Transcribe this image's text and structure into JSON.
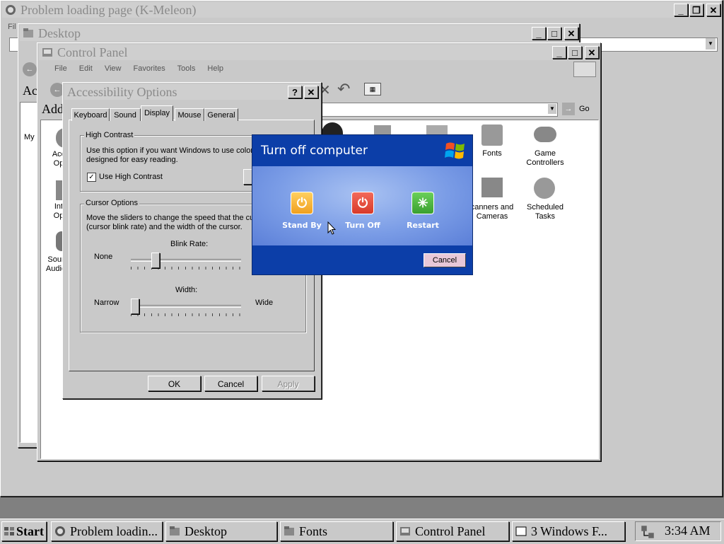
{
  "browser": {
    "title": "Problem loading page (K-Meleon)",
    "menu_first_letter": "Fil"
  },
  "desktop_window": {
    "title": "Desktop"
  },
  "control_panel": {
    "title": "Control Panel",
    "menu": [
      "File",
      "Edit",
      "View",
      "Favorites",
      "Tools",
      "Help"
    ],
    "address_label": "Add",
    "go_label": "Go",
    "left_fragment_1": "Ac",
    "left_fragment_2": "My",
    "icons": [
      {
        "label": "Acc\nOp"
      },
      {
        "label": "Int\nOp"
      },
      {
        "label": "Sour\nAudio"
      },
      {
        "label": "Fonts"
      },
      {
        "label": "Game\nControllers"
      },
      {
        "label": "canners and\nCameras"
      },
      {
        "label": "Scheduled\nTasks"
      }
    ]
  },
  "accessibility": {
    "title": "Accessibility Options",
    "tabs": [
      "Keyboard",
      "Sound",
      "Display",
      "Mouse",
      "General"
    ],
    "active_tab": "Display",
    "high_contrast": {
      "legend": "High Contrast",
      "desc_line1": "Use this option if you want Windows to use colors",
      "desc_line2": "designed for easy reading.",
      "checkbox_label": "Use High Contrast",
      "checked": true
    },
    "cursor_options": {
      "legend": "Cursor Options",
      "desc_line1": "Move the sliders to change the speed that the cur",
      "desc_line2": "(cursor blink rate) and the width of the cursor.",
      "blink_label": "Blink Rate:",
      "blink_min": "None",
      "blink_value": 0.2,
      "width_label": "Width:",
      "width_min": "Narrow",
      "width_max": "Wide",
      "width_value": 0.0
    },
    "buttons": {
      "ok": "OK",
      "cancel": "Cancel",
      "apply": "Apply"
    }
  },
  "turn_off": {
    "title": "Turn off computer",
    "options": [
      {
        "label": "Stand By",
        "color": "#f0a020"
      },
      {
        "label": "Turn Off",
        "color": "#d83a2a"
      },
      {
        "label": "Restart",
        "color": "#3aa030"
      }
    ],
    "cancel": "Cancel"
  },
  "taskbar": {
    "start": "Start",
    "items": [
      "Problem loadin...",
      "Desktop",
      "Fonts",
      "Control Panel",
      "3  Windows F..."
    ],
    "group_count": "3",
    "clock": "3:34 AM"
  },
  "colors": {
    "xp_blue": "#0c3ea8",
    "xp_mid": "#6a8ee0",
    "classic_gray": "#c9c9c9"
  }
}
